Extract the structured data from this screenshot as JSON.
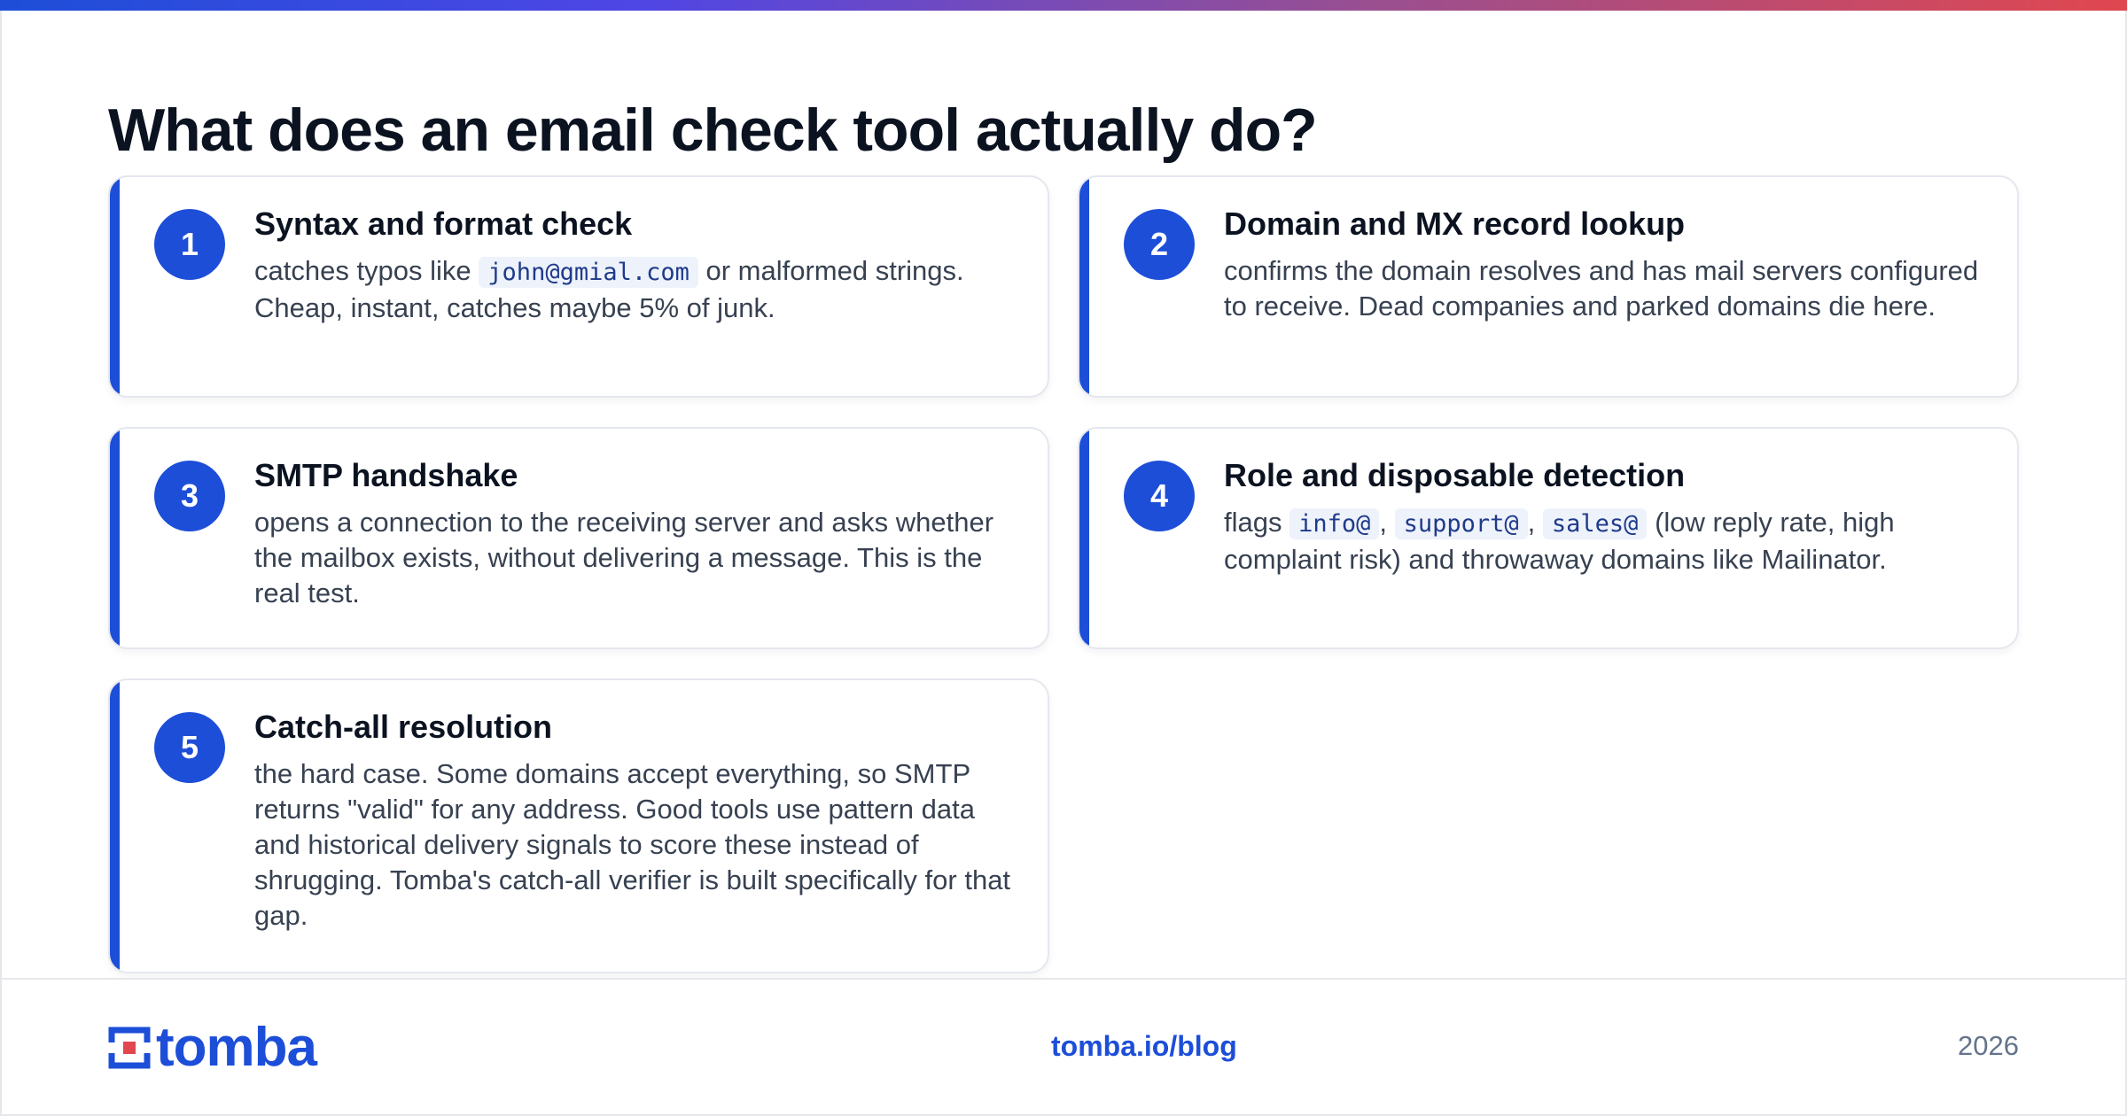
{
  "title": "What does an email check tool actually do?",
  "colors": {
    "accent": "#1d4ed8",
    "logo_red": "#e0474f"
  },
  "cards": [
    {
      "number": "1",
      "title": "Syntax and format check",
      "body_before": "catches typos like ",
      "code": [
        "john@gmial.com"
      ],
      "body_after": " or malformed strings. Cheap, instant, catches maybe 5% of junk."
    },
    {
      "number": "2",
      "title": "Domain and MX record lookup",
      "body": "confirms the domain resolves and has mail servers configured to receive. Dead companies and parked domains die here."
    },
    {
      "number": "3",
      "title": "SMTP handshake",
      "body": "opens a connection to the receiving server and asks whether the mailbox exists, without delivering a message. This is the real test."
    },
    {
      "number": "4",
      "title": "Role and disposable detection",
      "body_before": "flags ",
      "code": [
        "info@",
        "support@",
        "sales@"
      ],
      "separator": ", ",
      "body_after": " (low reply rate, high complaint risk) and throwaway domains like Mailinator."
    },
    {
      "number": "5",
      "title": "Catch-all resolution",
      "body": "the hard case. Some domains accept everything, so SMTP returns \"valid\" for any address. Good tools use pattern data and historical delivery signals to score these instead of shrugging. Tomba's catch-all verifier is built specifically for that gap."
    }
  ],
  "footer": {
    "logo_text": "tomba",
    "logo_icon": "tomba-logo-icon",
    "link": "tomba.io/blog",
    "year": "2026"
  }
}
